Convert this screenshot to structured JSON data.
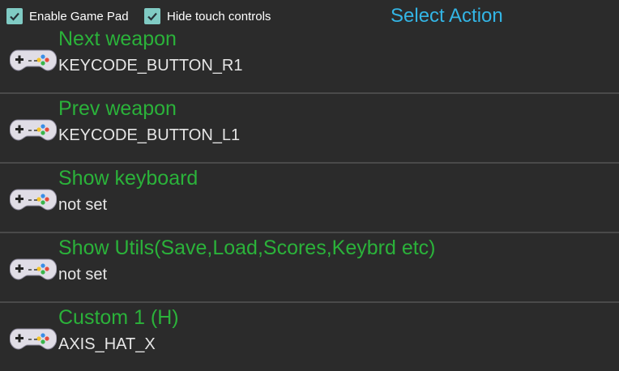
{
  "header": {
    "enable_gamepad_label": "Enable Game Pad",
    "enable_gamepad_checked": true,
    "hide_touch_label": "Hide touch controls",
    "hide_touch_checked": true,
    "title": "Select Action"
  },
  "actions": [
    {
      "name": "Next weapon",
      "value": "KEYCODE_BUTTON_R1",
      "icon": "gamepad-icon"
    },
    {
      "name": "Prev weapon",
      "value": "KEYCODE_BUTTON_L1",
      "icon": "gamepad-icon"
    },
    {
      "name": "Show keyboard",
      "value": "not set",
      "icon": "gamepad-icon"
    },
    {
      "name": "Show Utils(Save,Load,Scores,Keybrd etc)",
      "value": "not set",
      "icon": "gamepad-icon"
    },
    {
      "name": "Custom 1 (H)",
      "value": "AXIS_HAT_X",
      "icon": "gamepad-icon"
    }
  ],
  "colors": {
    "background": "#2b2b2b",
    "action_name": "#2bb23a",
    "title": "#33b5e5",
    "checkbox": "#80cbc4"
  }
}
